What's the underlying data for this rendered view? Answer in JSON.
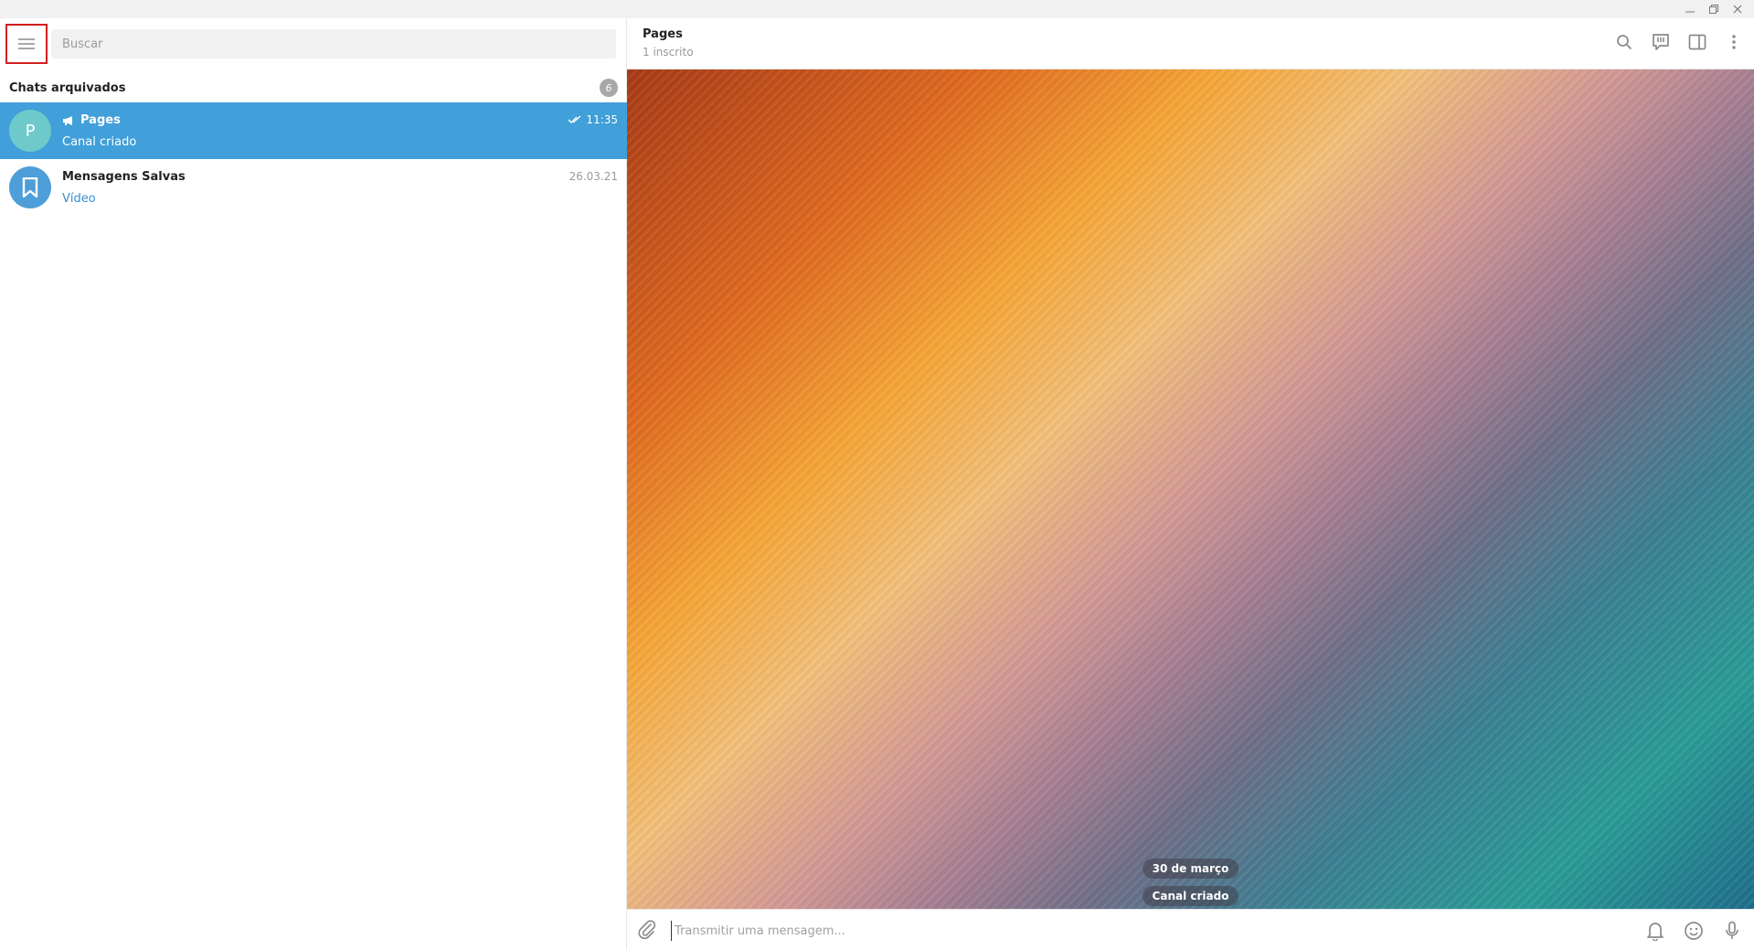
{
  "window": {
    "controls": [
      "minimize-icon",
      "restore-icon",
      "close-icon"
    ]
  },
  "sidebar": {
    "search_placeholder": "Buscar",
    "archived": {
      "title": "Chats arquivados",
      "count": "6"
    },
    "chats": [
      {
        "initial": "P",
        "name": "Pages",
        "preview": "Canal criado",
        "time": "11:35",
        "active": true,
        "avatar_color": "#6ec9cb"
      },
      {
        "name": "Mensagens Salvas",
        "preview": "Vídeo",
        "time": "26.03.21",
        "active": false,
        "avatar_color": "#4d9ed9"
      }
    ]
  },
  "chat": {
    "title": "Pages",
    "subtitle": "1 inscrito",
    "date_pill": "30 de março",
    "service_message": "Canal criado",
    "composer_placeholder": "Transmitir uma mensagem..."
  },
  "colors": {
    "accent": "#419fd9",
    "highlight_border": "#d11f1f"
  }
}
